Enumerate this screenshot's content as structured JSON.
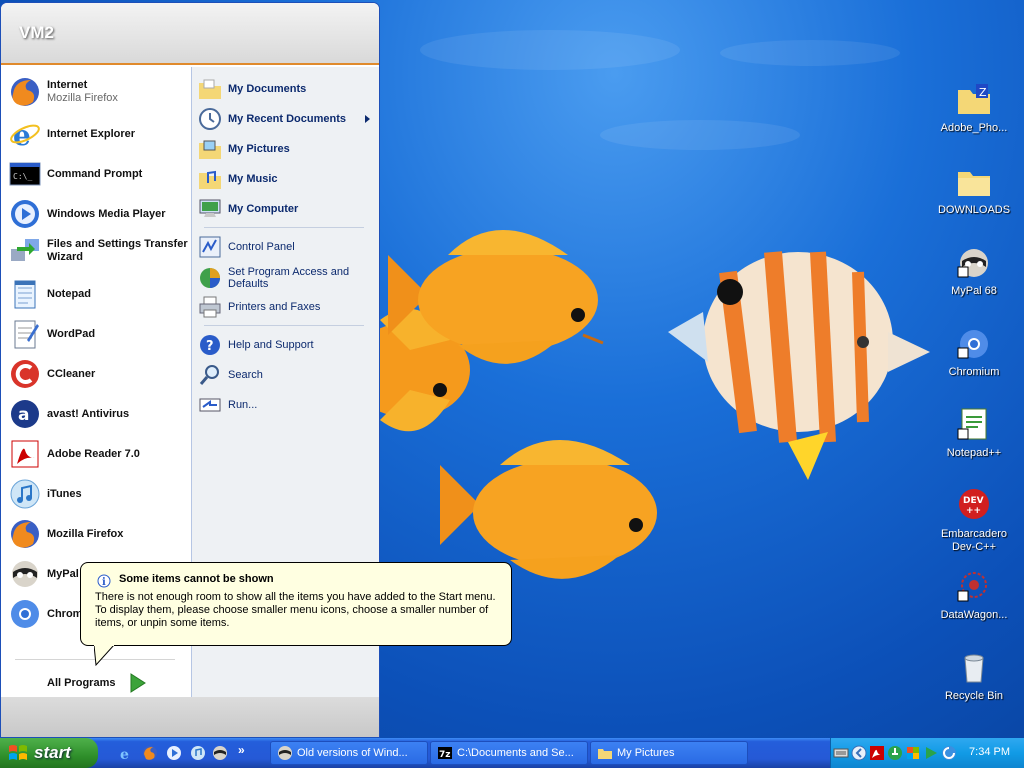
{
  "start_menu": {
    "user_name": "VM2",
    "pinned": [
      {
        "title": "Internet",
        "subtitle": "Mozilla Firefox",
        "icon": "firefox-icon"
      },
      {
        "title": "Internet Explorer",
        "icon": "internet-explorer-icon"
      }
    ],
    "programs": [
      {
        "title": "Command Prompt",
        "icon": "command-prompt-icon"
      },
      {
        "title": "Windows Media Player",
        "icon": "media-player-icon"
      },
      {
        "title": "Files and Settings Transfer Wizard",
        "icon": "transfer-wizard-icon"
      },
      {
        "title": "Notepad",
        "icon": "notepad-icon"
      },
      {
        "title": "WordPad",
        "icon": "wordpad-icon"
      },
      {
        "title": "CCleaner",
        "icon": "ccleaner-icon"
      },
      {
        "title": "avast! Antivirus",
        "icon": "avast-icon"
      },
      {
        "title": "Adobe Reader 7.0",
        "icon": "adobe-reader-icon"
      },
      {
        "title": "iTunes",
        "icon": "itunes-icon"
      },
      {
        "title": "Mozilla Firefox",
        "icon": "firefox-icon"
      },
      {
        "title": "MyPal",
        "icon": "mypal-icon"
      },
      {
        "title": "Chrom",
        "icon": "chromium-icon"
      }
    ],
    "all_programs": "All Programs",
    "places": [
      {
        "title": "My Documents",
        "bold": true,
        "icon": "folder-documents-icon"
      },
      {
        "title": "My Recent Documents",
        "bold": true,
        "icon": "recent-documents-icon",
        "submenu": true
      },
      {
        "title": "My Pictures",
        "bold": true,
        "icon": "folder-pictures-icon"
      },
      {
        "title": "My Music",
        "bold": true,
        "icon": "folder-music-icon"
      },
      {
        "title": "My Computer",
        "bold": true,
        "icon": "computer-icon"
      }
    ],
    "settings": [
      {
        "title": "Control Panel",
        "icon": "control-panel-icon"
      },
      {
        "title": "Set Program Access and Defaults",
        "icon": "program-access-icon"
      },
      {
        "title": "Printers and Faxes",
        "icon": "printer-icon"
      }
    ],
    "help": [
      {
        "title": "Help and Support",
        "icon": "help-icon"
      },
      {
        "title": "Search",
        "icon": "search-icon"
      },
      {
        "title": "Run...",
        "icon": "run-icon"
      }
    ]
  },
  "balloon": {
    "title": "Some items cannot be shown",
    "text": "There is not enough room to show all the items you have added to the Start menu. To display them, please choose smaller menu icons, choose a smaller number of items, or unpin some items."
  },
  "desktop_icons": [
    {
      "label": "Adobe_Pho...",
      "icon": "zip-folder-icon"
    },
    {
      "label": "DOWNLOADS",
      "icon": "folder-icon"
    },
    {
      "label": "MyPal 68",
      "icon": "mypal-icon"
    },
    {
      "label": "Chromium",
      "icon": "chromium-icon"
    },
    {
      "label": "Notepad++",
      "icon": "notepad-plus-icon"
    },
    {
      "label": "Embarcadero Dev-C++",
      "icon": "devcpp-icon"
    },
    {
      "label": "DataWagon...",
      "icon": "datawagon-icon"
    },
    {
      "label": "Recycle Bin",
      "icon": "recycle-bin-icon"
    }
  ],
  "taskbar": {
    "start_label": "start",
    "overflow_chevron": "»",
    "tasks": [
      {
        "label": "Old versions of Wind...",
        "icon": "raccoon-icon"
      },
      {
        "label": "C:\\Documents and Se...",
        "icon": "7zip-icon"
      },
      {
        "label": "My Pictures",
        "icon": "folder-icon"
      }
    ],
    "clock": "7:34 PM"
  },
  "colors": {
    "taskbar_blue": "#245edb",
    "start_green": "#2f8f2b",
    "menu_accent": "#e08a2c",
    "balloon_bg": "#ffffe1"
  }
}
